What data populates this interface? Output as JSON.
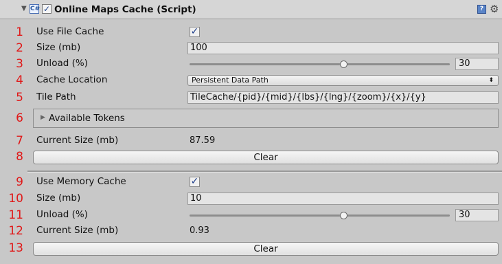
{
  "header": {
    "title": "Online Maps Cache (Script)",
    "enabled": true,
    "script_glyph": "C#",
    "icons": [
      "foldout-arrow-icon",
      "script-icon",
      "enable-checkbox",
      "help-book-icon",
      "gear-icon"
    ]
  },
  "file_cache": {
    "use_num": "1",
    "use_label": "Use File Cache",
    "use_checked": true,
    "size_num": "2",
    "size_label": "Size (mb)",
    "size_value": "100",
    "unload_num": "3",
    "unload_label": "Unload (%)",
    "unload_value": "30",
    "unload_fraction": 0.59,
    "location_num": "4",
    "location_label": "Cache Location",
    "location_value": "Persistent Data Path",
    "tile_num": "5",
    "tile_label": "Tile Path",
    "tile_value": "TileCache/{pid}/{mid}/{lbs}/{lng}/{zoom}/{x}/{y}",
    "tokens_num": "6",
    "tokens_label": "Available Tokens",
    "current_num": "7",
    "current_label": "Current Size (mb)",
    "current_value": "87.59",
    "clear_num": "8",
    "clear_label": "Clear"
  },
  "memory_cache": {
    "use_num": "9",
    "use_label": "Use Memory Cache",
    "use_checked": true,
    "size_num": "10",
    "size_label": "Size (mb)",
    "size_value": "10",
    "unload_num": "11",
    "unload_label": "Unload (%)",
    "unload_value": "30",
    "unload_fraction": 0.59,
    "current_num": "12",
    "current_label": "Current Size (mb)",
    "current_value": "0.93",
    "clear_num": "13",
    "clear_label": "Clear"
  }
}
